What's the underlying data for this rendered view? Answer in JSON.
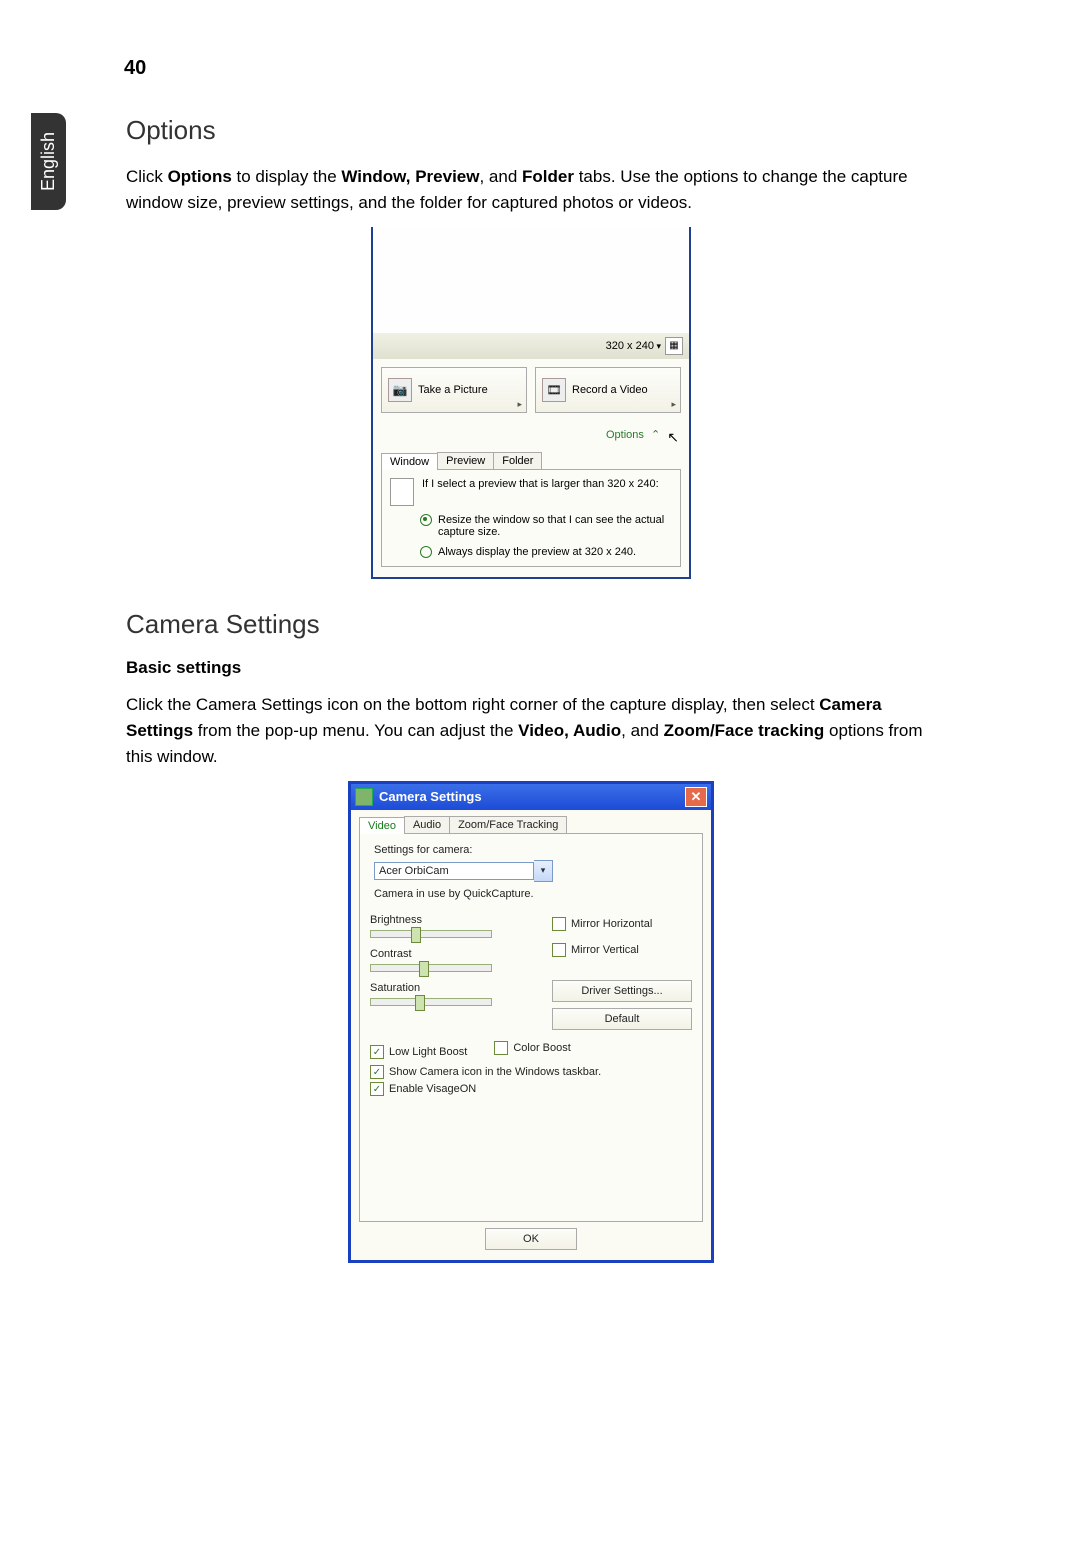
{
  "page_number": "40",
  "side_tab": "English",
  "section_options_title": "Options",
  "options_paragraph_prefix": "Click ",
  "options_bold1": "Options",
  "options_p_mid1": " to display the ",
  "options_bold2": "Window, Preview",
  "options_p_mid2": ", and ",
  "options_bold3": "Folder",
  "options_p_tail": " tabs. Use the options to change the capture window size, preview settings, and the folder for captured photos or videos.",
  "fig1": {
    "resolution": "320 x 240",
    "take_picture": "Take a Picture",
    "record_video": "Record a Video",
    "options_link": "Options",
    "tabs": [
      "Window",
      "Preview",
      "Folder"
    ],
    "prompt": "If I select a preview that is larger than 320 x 240:",
    "radio1": "Resize the window so that I can see the actual capture size.",
    "radio2": "Always display the preview at 320 x 240."
  },
  "section_camera_title": "Camera Settings",
  "basic_settings": "Basic settings",
  "camera_paragraph_prefix": "Click the Camera Settings icon on the bottom right corner of the capture display, then select ",
  "camera_bold1": "Camera Settings",
  "camera_p_mid1": " from the pop-up menu. You can adjust the ",
  "camera_bold2": "Video, Audio",
  "camera_p_mid2": ", and ",
  "camera_bold3": "Zoom/Face tracking",
  "camera_p_tail": " options from this window.",
  "fig2": {
    "title": "Camera Settings",
    "tabs": [
      "Video",
      "Audio",
      "Zoom/Face Tracking"
    ],
    "settings_for_camera": "Settings for camera:",
    "camera_name": "Acer OrbiCam",
    "in_use": "Camera in use by QuickCapture.",
    "brightness": "Brightness",
    "contrast": "Contrast",
    "saturation": "Saturation",
    "mirror_h": "Mirror Horizontal",
    "mirror_v": "Mirror Vertical",
    "driver_settings": "Driver Settings...",
    "default": "Default",
    "low_light": "Low Light Boost",
    "color_boost": "Color Boost",
    "show_taskbar": "Show Camera icon in the Windows taskbar.",
    "enable_visageon": "Enable VisageON",
    "ok": "OK"
  }
}
